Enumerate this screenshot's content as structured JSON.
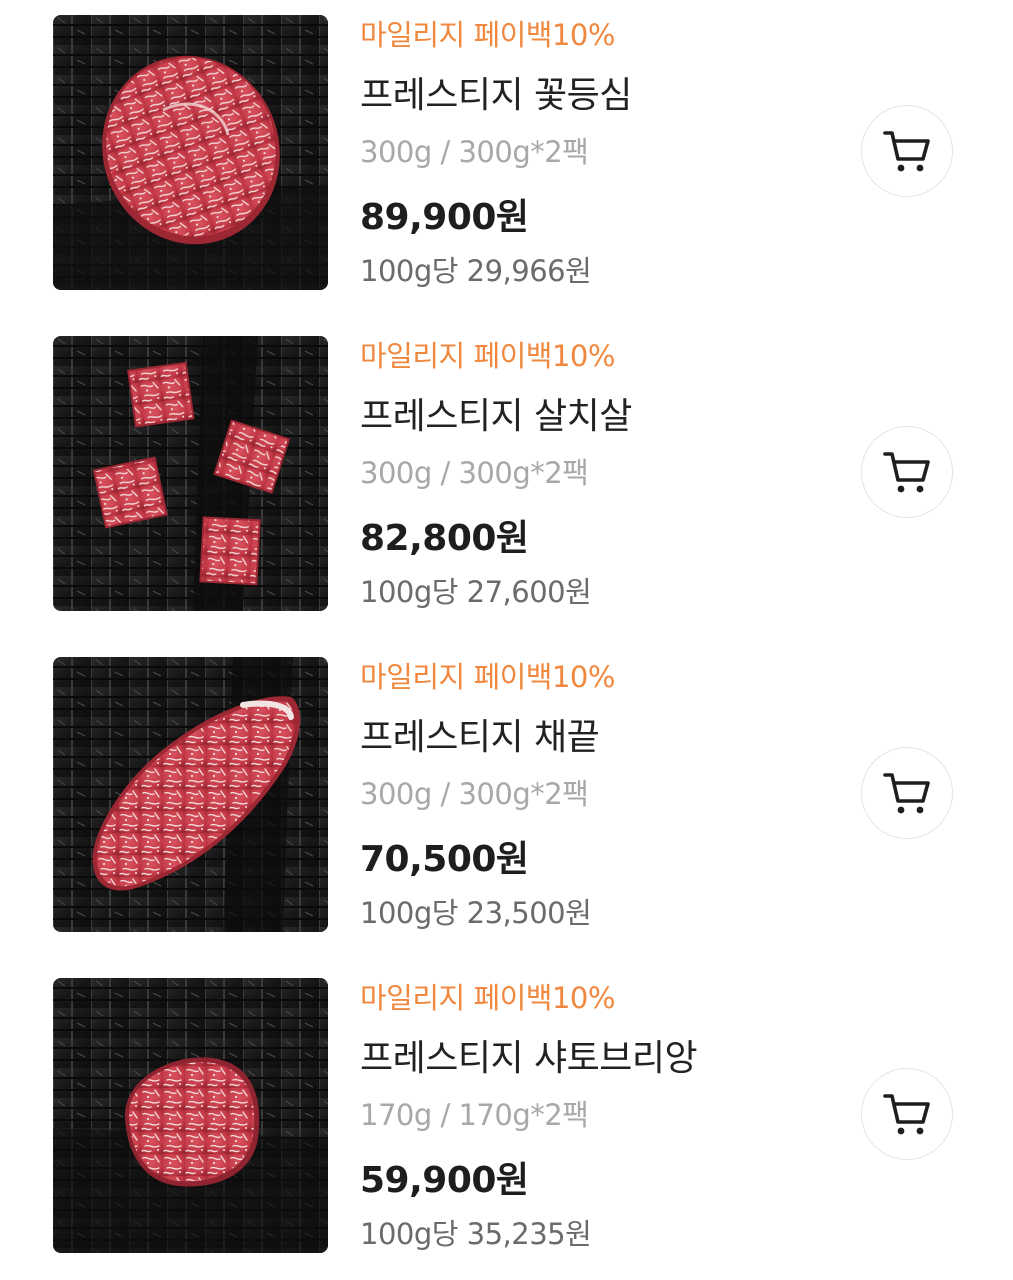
{
  "products": [
    {
      "badge": "마일리지 페이백10%",
      "name": "프레스티지 꽃등심",
      "weight": "300g / 300g*2팩",
      "price": "89,900원",
      "unit_price": "100g당 29,966원",
      "image": "ribeye-steak-on-charcoal"
    },
    {
      "badge": "마일리지 페이백10%",
      "name": "프레스티지 살치살",
      "weight": "300g / 300g*2팩",
      "price": "82,800원",
      "unit_price": "100g당 27,600원",
      "image": "chuck-flap-cubes-on-charcoal"
    },
    {
      "badge": "마일리지 페이백10%",
      "name": "프레스티지 채끝",
      "weight": "300g / 300g*2팩",
      "price": "70,500원",
      "unit_price": "100g당 23,500원",
      "image": "striploin-steak-on-charcoal"
    },
    {
      "badge": "마일리지 페이백10%",
      "name": "프레스티지 샤토브리앙",
      "weight": "170g / 170g*2팩",
      "price": "59,900원",
      "unit_price": "100g당 35,235원",
      "image": "chateaubriand-steak-on-charcoal"
    }
  ],
  "icons": {
    "cart": "cart-icon"
  },
  "colors": {
    "badge": "#f0893f",
    "name": "#222222",
    "weight": "#a8a8a8",
    "price": "#1e1e1e",
    "unit_price": "#6b6b6b",
    "cart_border": "#e3e3e3",
    "cart_icon": "#1e1e1e"
  }
}
